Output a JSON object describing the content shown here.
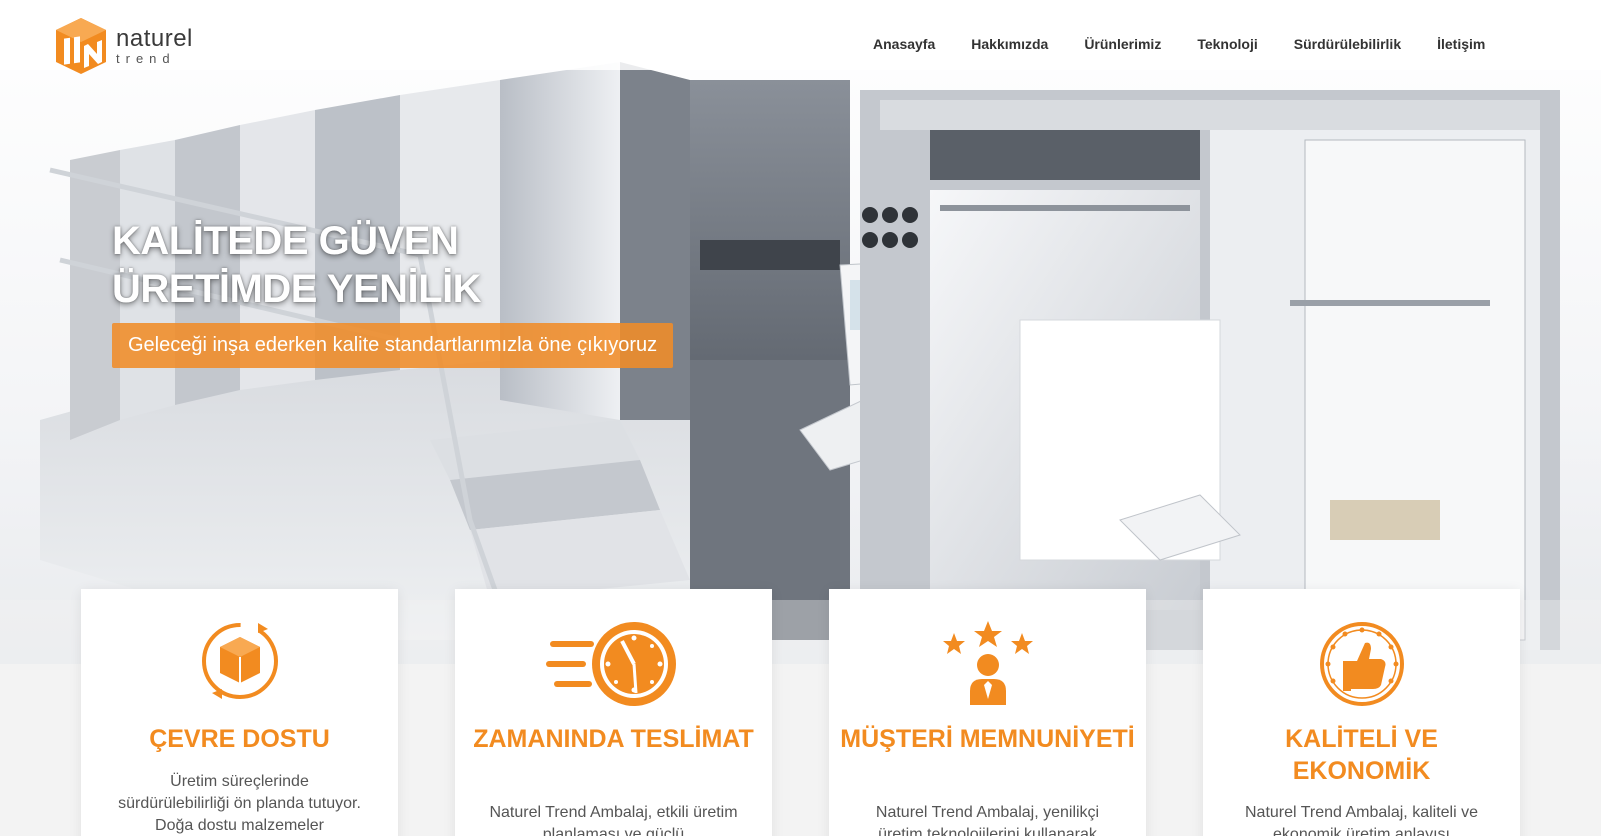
{
  "brand": {
    "name": "naturel",
    "sub": "trend",
    "accent": "#f28b20"
  },
  "nav": {
    "items": [
      {
        "label": "Anasayfa"
      },
      {
        "label": "Hakkımızda"
      },
      {
        "label": "Ürünlerimiz"
      },
      {
        "label": "Teknoloji"
      },
      {
        "label": "Sürdürülebilirlik"
      },
      {
        "label": "İletişim"
      }
    ]
  },
  "hero": {
    "title_line1": "KALİTEDE GÜVEN",
    "title_line2": "ÜRETİMDE YENİLİK",
    "subtitle": "Geleceği inşa ederken kalite standartlarımızla öne çıkıyoruz",
    "image": "printing-machine"
  },
  "features": [
    {
      "icon": "box-recycle-icon",
      "title": "ÇEVRE DOSTU",
      "text": "Üretim süreçlerinde sürdürülebilirliği ön planda tutuyor. Doğa dostu malzemeler"
    },
    {
      "icon": "fast-clock-icon",
      "title": "ZAMANINDA TESLİMAT",
      "text": "Naturel Trend Ambalaj, etkili üretim planlaması ve güçlü"
    },
    {
      "icon": "customer-stars-icon",
      "title": "MÜŞTERİ MEMNUNİYETİ",
      "text": "Naturel Trend Ambalaj, yenilikçi üretim teknolojilerini kullanarak"
    },
    {
      "icon": "thumbs-up-stars-icon",
      "title": "KALİTELİ VE EKONOMİK",
      "text": "Naturel Trend Ambalaj, kaliteli ve ekonomik üretim anlayışı"
    }
  ]
}
